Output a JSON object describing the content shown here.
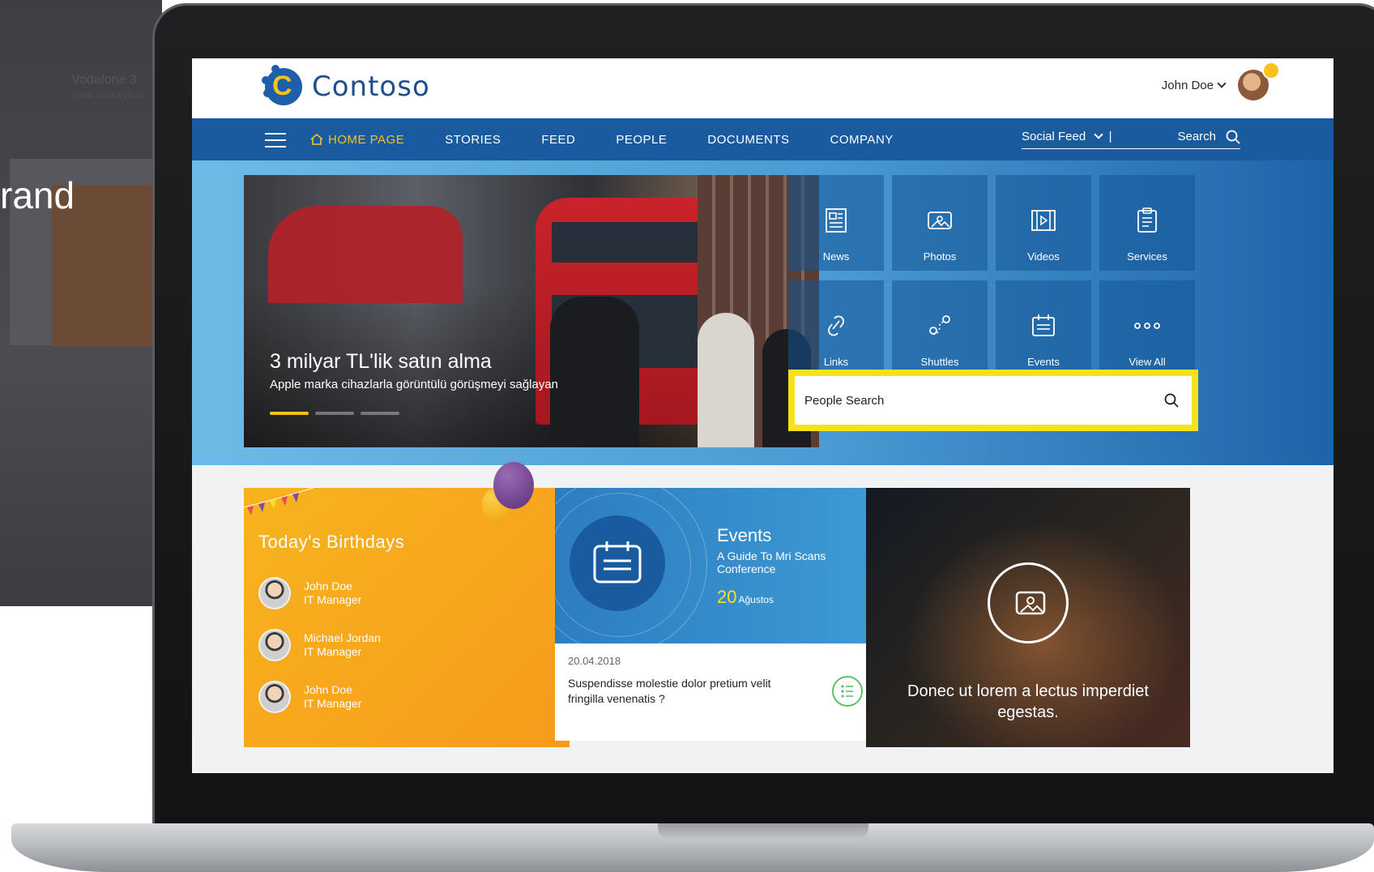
{
  "background": {
    "headline": "Vodafone 3",
    "sub": "Apple marka cihaz",
    "brand_fragment": "rand"
  },
  "header": {
    "app_name": "Contoso",
    "user_name": "John Doe"
  },
  "nav": {
    "items": [
      {
        "label": "HOME PAGE",
        "active": true
      },
      {
        "label": "STORIES"
      },
      {
        "label": "FEED"
      },
      {
        "label": "PEOPLE"
      },
      {
        "label": "DOCUMENTS"
      },
      {
        "label": "COMPANY"
      }
    ],
    "social_feed": "Social Feed",
    "search_label": "Search"
  },
  "hero": {
    "title": "3 milyar TL'lik satın alma",
    "subtitle": "Apple marka cihazlarla görüntülü görüşmeyi sağlayan",
    "slide_count": 3,
    "active_slide": 1
  },
  "quick_links": [
    {
      "label": "News",
      "icon": "newspaper-icon"
    },
    {
      "label": "Photos",
      "icon": "photo-icon"
    },
    {
      "label": "Videos",
      "icon": "video-icon"
    },
    {
      "label": "Services",
      "icon": "clipboard-icon"
    },
    {
      "label": "Links",
      "icon": "link-icon"
    },
    {
      "label": "Shuttles",
      "icon": "route-icon"
    },
    {
      "label": "Events",
      "icon": "calendar-icon"
    },
    {
      "label": "View All",
      "icon": "more-icon"
    }
  ],
  "people_search": {
    "placeholder": "People Search"
  },
  "birthdays": {
    "title": "Today's Birthdays",
    "people": [
      {
        "name": "John Doe",
        "role": "IT Manager"
      },
      {
        "name": "Michael Jordan",
        "role": "IT Manager"
      },
      {
        "name": "John Doe",
        "role": "IT Manager"
      }
    ]
  },
  "events": {
    "title": "Events",
    "subtitle": "A Guide To Mri Scans Conference",
    "day": "20",
    "month": "Ağustos"
  },
  "post": {
    "date": "20.04.2018",
    "text": "Suspendisse molestie dolor pretium velit fringilla venenatis ?"
  },
  "gallery": {
    "caption": "Donec ut lorem a lectus imperdiet egestas."
  },
  "colors": {
    "brand_blue": "#1a5ba0",
    "accent_yellow": "#f7c21c",
    "birthday_orange": "#f7a81d",
    "events_blue": "#3e9ad4"
  }
}
